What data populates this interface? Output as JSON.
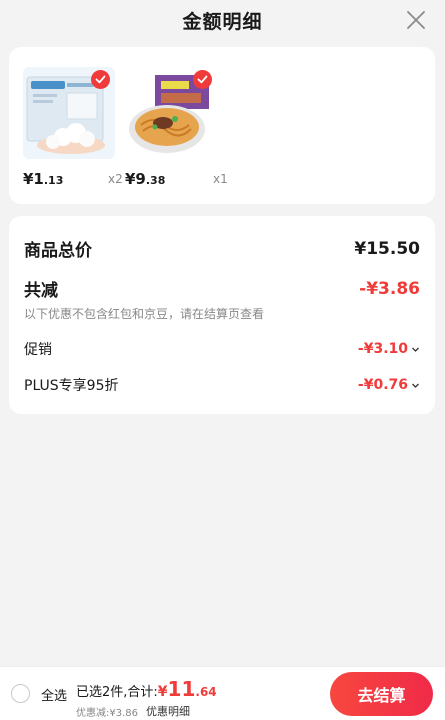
{
  "header": {
    "title": "金额明细"
  },
  "products": [
    {
      "price_main": "¥1",
      "price_sub": ".13",
      "qty": "x2"
    },
    {
      "price_main": "¥9",
      "price_sub": ".38",
      "qty": "x1"
    }
  ],
  "summary": {
    "total_label": "商品总价",
    "total_value": "¥15.50",
    "reduce_label": "共减",
    "reduce_value": "-¥3.86",
    "note": "以下优惠不包含红包和京豆，请在结算页查看",
    "promo_label": "促销",
    "promo_value": "-¥3.10",
    "plus_label": "PLUS专享95折",
    "plus_value": "-¥0.76"
  },
  "bottom": {
    "select_all": "全选",
    "selected_text": "已选2件,合计:",
    "total_symbol": "¥",
    "total_main": "11",
    "total_sub": ".64",
    "discount_text": "优惠减:¥3.86",
    "detail_link": "优惠明细",
    "checkout_label": "去结算"
  },
  "colors": {
    "accent": "#f03b3b"
  }
}
